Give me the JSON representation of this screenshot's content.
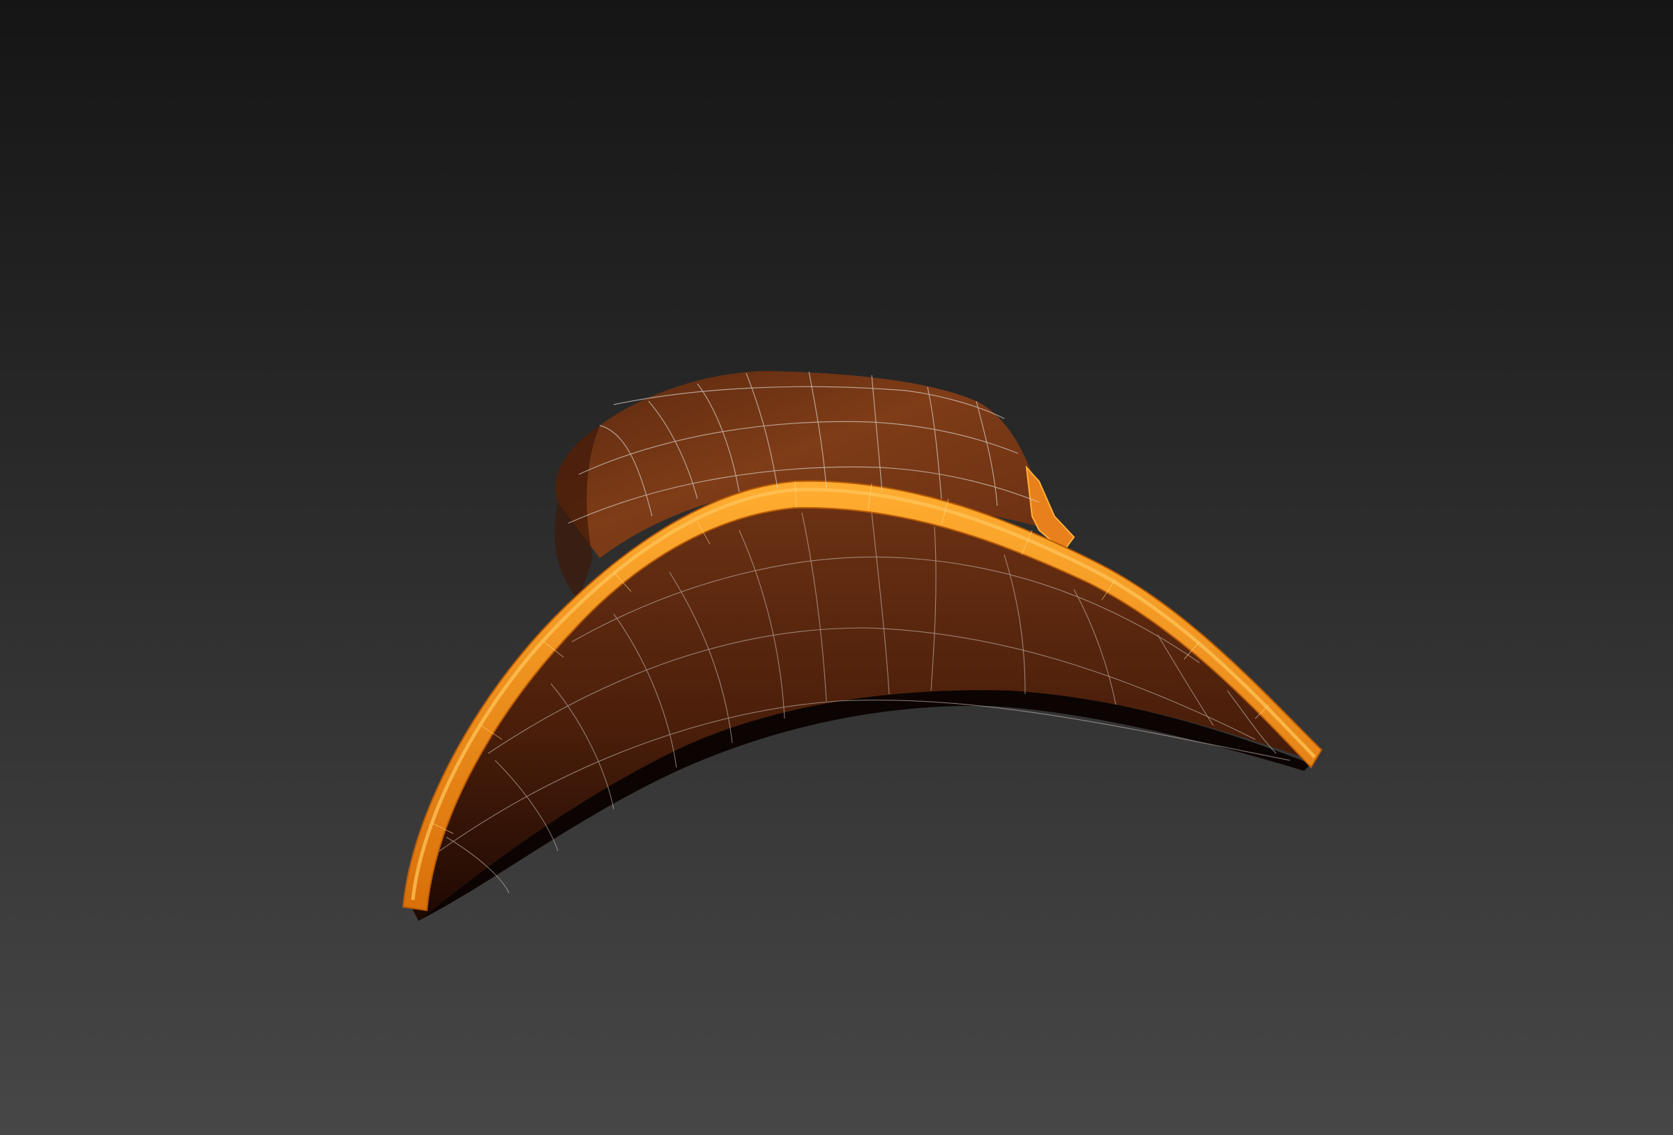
{
  "viewport": {
    "object": "hat-model",
    "view_mode": "shaded-with-wireframe",
    "colors": {
      "bg_top": "#151515",
      "bg_bottom": "#454545",
      "hat_body": "#7a3a16",
      "hat_shadow": "#2a0e04",
      "brim_band": "#f08a10",
      "band_highlight": "#ffb13a",
      "wire": "#d8d0c8",
      "frame": "#5f5e58"
    }
  }
}
